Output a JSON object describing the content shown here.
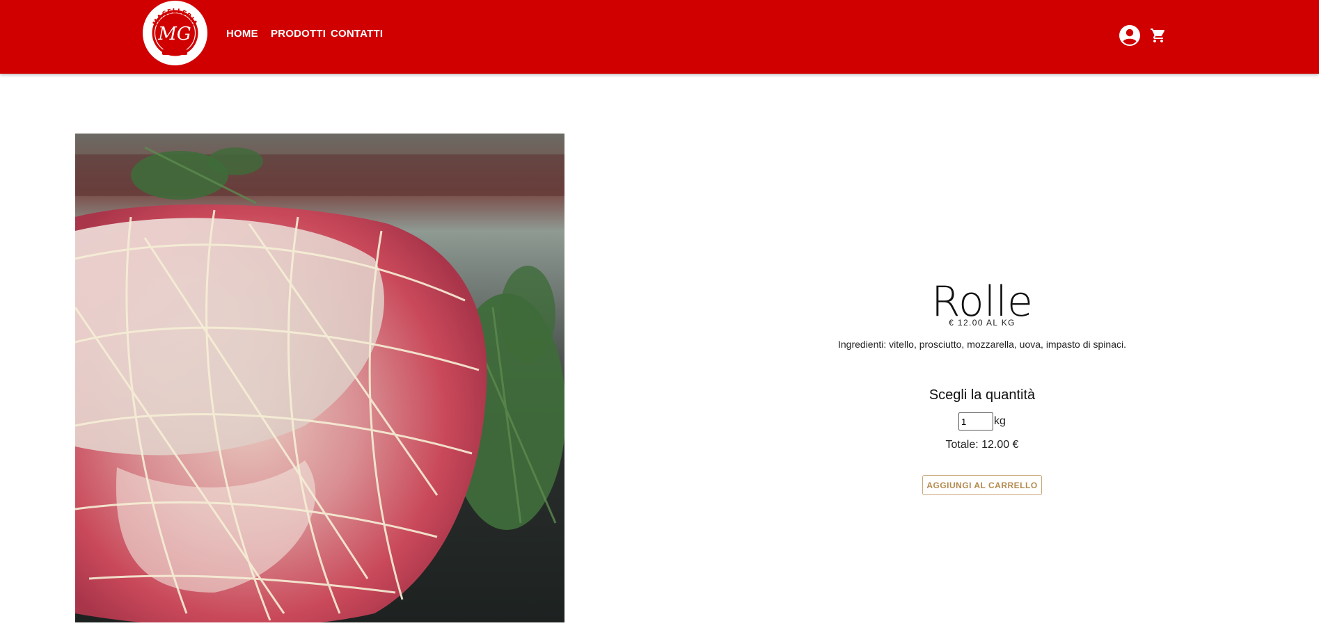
{
  "header": {
    "background_color": "#d10000",
    "logo": {
      "text": "MACELLERIA",
      "monogram": "MG"
    },
    "nav": [
      {
        "label": "HOME"
      },
      {
        "label": "PRODOTTI"
      },
      {
        "label": "CONTATTI"
      }
    ],
    "icons": [
      "account-circle-icon",
      "shopping-cart-icon"
    ]
  },
  "product": {
    "title": "Rolle",
    "price": "€ 12.00 AL KG",
    "ingredients": "Ingredienti: vitello, prosciutto, mozzarella, uova, impasto di spinaci.",
    "quantity_heading": "Scegli la quantità",
    "quantity_value": "1",
    "quantity_unit": "kg",
    "total": "Totale: 12.00 €",
    "add_to_cart_label": "AGGIUNGI AL CARRELLO",
    "button_color": "#b48a4e"
  }
}
